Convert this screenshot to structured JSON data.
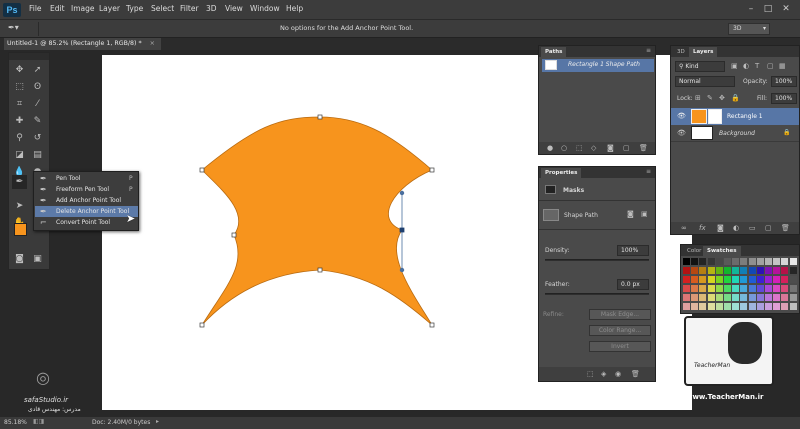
{
  "app": {
    "logo": "Ps"
  },
  "menu": [
    "File",
    "Edit",
    "Image",
    "Layer",
    "Type",
    "Select",
    "Filter",
    "3D",
    "View",
    "Window",
    "Help"
  ],
  "window_buttons": {
    "min": "–",
    "max": "□",
    "close": "✕"
  },
  "options_bar": {
    "tool_glyph": "✒▾",
    "message": "No options for the Add Anchor Point Tool.",
    "workspace": "3D"
  },
  "document": {
    "tab_label": "Untitled-1 @ 85.2% (Rectangle 1, RGB/8) *",
    "close": "×"
  },
  "tool_flyout": [
    {
      "label": "Pen Tool",
      "key": "P",
      "icon": "✒"
    },
    {
      "label": "Freeform Pen Tool",
      "key": "P",
      "icon": "✒"
    },
    {
      "label": "Add Anchor Point Tool",
      "key": "",
      "icon": "✒"
    },
    {
      "label": "Delete Anchor Point Tool",
      "key": "",
      "icon": "✒"
    },
    {
      "label": "Convert Point Tool",
      "key": "",
      "icon": "⌐"
    }
  ],
  "colors": {
    "foreground": "#f7941d",
    "background": "#ffffff",
    "shape_fill": "#f7941d",
    "shape_stroke": "#b86a10",
    "selection": "#5776a6"
  },
  "paths_panel": {
    "tab": "Paths",
    "item": "Rectangle 1 Shape Path"
  },
  "properties_panel": {
    "tab": "Properties",
    "section": "Masks",
    "shape_path": "Shape Path",
    "density_label": "Density:",
    "density_value": "100%",
    "feather_label": "Feather:",
    "feather_value": "0.0 px",
    "refine_label": "Refine:",
    "mask_edge": "Mask Edge...",
    "color_range": "Color Range...",
    "invert": "Invert"
  },
  "layers_panel": {
    "tab_3d": "3D",
    "tab_layers": "Layers",
    "kind": "Kind",
    "blend": "Normal",
    "opacity_label": "Opacity:",
    "opacity_value": "100%",
    "lock_label": "Lock:",
    "fill_label": "Fill:",
    "fill_value": "100%",
    "layers": [
      "Rectangle 1",
      "Background"
    ]
  },
  "swatches_panel": {
    "tab_color": "Color",
    "tab_swatches": "Swatches"
  },
  "status_bar": {
    "zoom": "85.18%",
    "doc": "Doc: 2.40M/0 bytes"
  },
  "watermarks": {
    "left_site": "safaStudio.ir",
    "left_name": "مدرس: مهندس قادی",
    "right_site": "www.TeacherMan.ir",
    "right_name": "TeacherMan"
  }
}
